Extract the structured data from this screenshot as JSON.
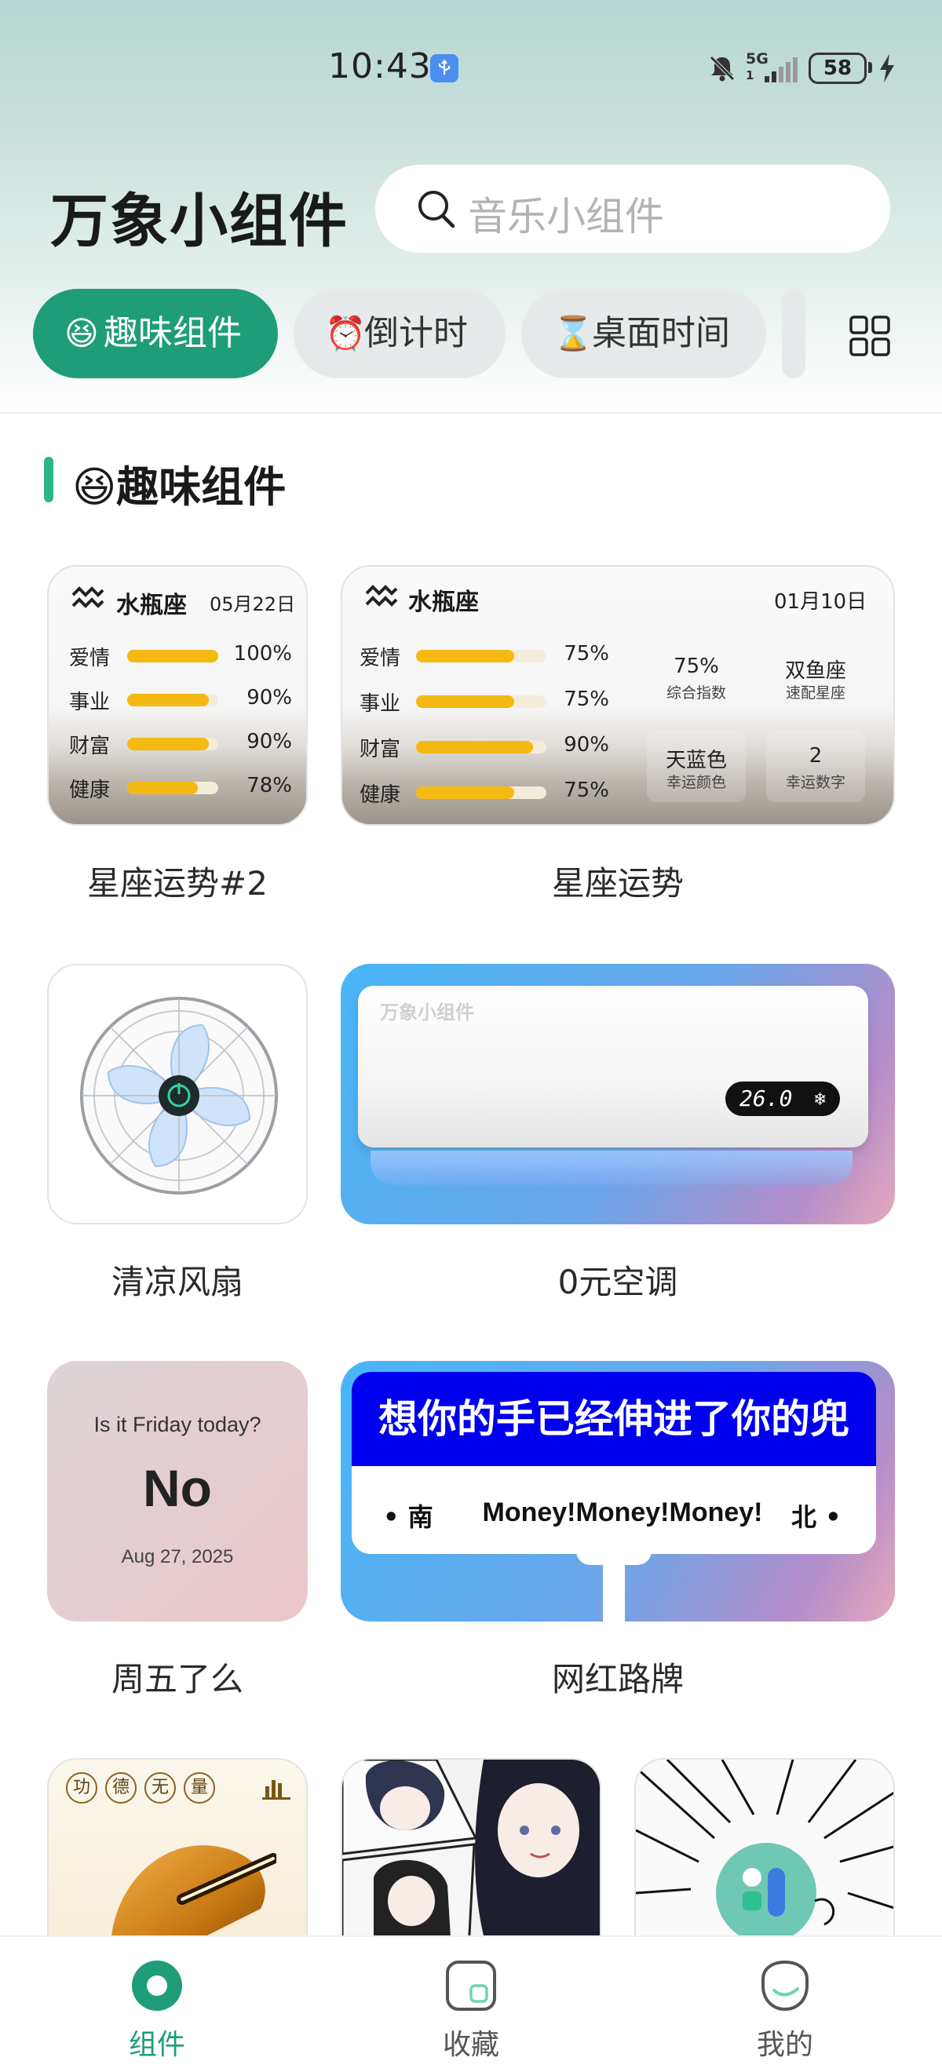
{
  "status_bar": {
    "time": "10:43",
    "network": "5G",
    "network_sub": "1",
    "battery": "58"
  },
  "header": {
    "title": "万象小组件",
    "search_placeholder": "音乐小组件"
  },
  "tabs": [
    {
      "label": "趣味组件",
      "active": true,
      "icon": "laughing-emoji"
    },
    {
      "label": "倒计时",
      "active": false,
      "icon": "alarm-clock-emoji"
    },
    {
      "label": "桌面时间",
      "active": false,
      "icon": "hourglass-emoji"
    }
  ],
  "section": {
    "title": "趣味组件",
    "icon": "laughing-emoji"
  },
  "widgets": {
    "horoscope_small": {
      "label": "星座运势#2",
      "sign": "水瓶座",
      "date": "05月22日",
      "rows": [
        {
          "name": "爱情",
          "value": "100%",
          "fill": 1.0
        },
        {
          "name": "事业",
          "value": "90%",
          "fill": 0.9
        },
        {
          "name": "财富",
          "value": "90%",
          "fill": 0.9
        },
        {
          "name": "健康",
          "value": "78%",
          "fill": 0.78
        }
      ]
    },
    "horoscope_wide": {
      "label": "星座运势",
      "sign": "水瓶座",
      "date": "01月10日",
      "rows": [
        {
          "name": "爱情",
          "value": "75%",
          "fill": 0.75
        },
        {
          "name": "事业",
          "value": "75%",
          "fill": 0.75
        },
        {
          "name": "财富",
          "value": "90%",
          "fill": 0.9
        },
        {
          "name": "健康",
          "value": "75%",
          "fill": 0.75
        }
      ],
      "stats": [
        {
          "value": "75%",
          "sub": "综合指数"
        },
        {
          "value": "双鱼座",
          "sub": "速配星座"
        },
        {
          "value": "天蓝色",
          "sub": "幸运颜色"
        },
        {
          "value": "2",
          "sub": "幸运数字"
        }
      ]
    },
    "fan": {
      "label": "清凉风扇"
    },
    "aircon": {
      "label": "0元空调",
      "brand": "万象小组件",
      "temperature": "26.0"
    },
    "friday": {
      "label": "周五了么",
      "question": "Is it Friday today?",
      "answer": "No",
      "date": "Aug 27, 2025"
    },
    "road_sign": {
      "label": "网红路牌",
      "headline": "想你的手已经伸进了你的兜",
      "left": "南",
      "middle": "Money!Money!Money!",
      "right": "北"
    },
    "muyu": {
      "chars": [
        "功",
        "德",
        "无",
        "量"
      ]
    }
  },
  "bottom_nav": [
    {
      "label": "组件",
      "active": true
    },
    {
      "label": "收藏",
      "active": false
    },
    {
      "label": "我的",
      "active": false
    }
  ],
  "colors": {
    "accent": "#1f9d78",
    "tab_inactive": "#e6eaea",
    "bar_fill": "#f5b914",
    "sign_blue": "#0000ee"
  }
}
